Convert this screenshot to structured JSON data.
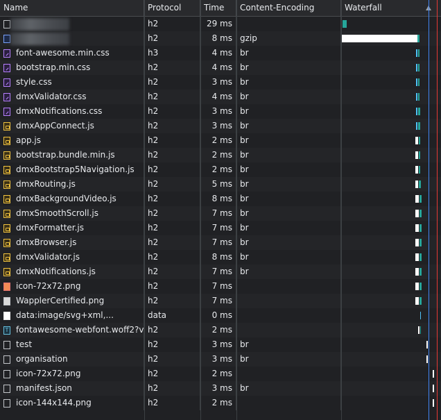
{
  "columns": {
    "name": "Name",
    "protocol": "Protocol",
    "time": "Time",
    "encoding": "Content-Encoding",
    "waterfall": "Waterfall"
  },
  "colors": {
    "background": "#202124",
    "blue_line": "#4285f4",
    "red_line": "#e53935",
    "teal_bar": "#26a69a"
  },
  "rows": [
    {
      "name": "",
      "blurred": true,
      "icon": "document-icon",
      "type": "doc",
      "protocol": "h2",
      "time": "29 ms",
      "encoding": ""
    },
    {
      "name": "",
      "blurred": true,
      "icon": "html-icon",
      "type": "html",
      "protocol": "h2",
      "time": "8 ms",
      "encoding": "gzip"
    },
    {
      "name": "font-awesome.min.css",
      "icon": "stylesheet-icon",
      "type": "css",
      "protocol": "h3",
      "time": "4 ms",
      "encoding": "br"
    },
    {
      "name": "bootstrap.min.css",
      "icon": "stylesheet-icon",
      "type": "css",
      "protocol": "h2",
      "time": "4 ms",
      "encoding": "br"
    },
    {
      "name": "style.css",
      "icon": "stylesheet-icon",
      "type": "css",
      "protocol": "h2",
      "time": "3 ms",
      "encoding": "br"
    },
    {
      "name": "dmxValidator.css",
      "icon": "stylesheet-icon",
      "type": "css",
      "protocol": "h2",
      "time": "4 ms",
      "encoding": "br"
    },
    {
      "name": "dmxNotifications.css",
      "icon": "stylesheet-icon",
      "type": "css",
      "protocol": "h2",
      "time": "3 ms",
      "encoding": "br"
    },
    {
      "name": "dmxAppConnect.js",
      "icon": "script-icon",
      "type": "js",
      "protocol": "h2",
      "time": "3 ms",
      "encoding": "br"
    },
    {
      "name": "app.js",
      "icon": "script-icon",
      "type": "js",
      "protocol": "h2",
      "time": "2 ms",
      "encoding": "br"
    },
    {
      "name": "bootstrap.bundle.min.js",
      "icon": "script-icon",
      "type": "js",
      "protocol": "h2",
      "time": "2 ms",
      "encoding": "br"
    },
    {
      "name": "dmxBootstrap5Navigation.js",
      "icon": "script-icon",
      "type": "js",
      "protocol": "h2",
      "time": "2 ms",
      "encoding": "br"
    },
    {
      "name": "dmxRouting.js",
      "icon": "script-icon",
      "type": "js",
      "protocol": "h2",
      "time": "5 ms",
      "encoding": "br"
    },
    {
      "name": "dmxBackgroundVideo.js",
      "icon": "script-icon",
      "type": "js",
      "protocol": "h2",
      "time": "8 ms",
      "encoding": "br"
    },
    {
      "name": "dmxSmoothScroll.js",
      "icon": "script-icon",
      "type": "js",
      "protocol": "h2",
      "time": "7 ms",
      "encoding": "br"
    },
    {
      "name": "dmxFormatter.js",
      "icon": "script-icon",
      "type": "js",
      "protocol": "h2",
      "time": "7 ms",
      "encoding": "br"
    },
    {
      "name": "dmxBrowser.js",
      "icon": "script-icon",
      "type": "js",
      "protocol": "h2",
      "time": "7 ms",
      "encoding": "br"
    },
    {
      "name": "dmxValidator.js",
      "icon": "script-icon",
      "type": "js",
      "protocol": "h2",
      "time": "8 ms",
      "encoding": "br"
    },
    {
      "name": "dmxNotifications.js",
      "icon": "script-icon",
      "type": "js",
      "protocol": "h2",
      "time": "7 ms",
      "encoding": "br"
    },
    {
      "name": "icon-72x72.png",
      "icon": "image-icon",
      "type": "img",
      "protocol": "h2",
      "time": "7 ms",
      "encoding": ""
    },
    {
      "name": "WapplerCertified.png",
      "icon": "image-icon",
      "type": "img2",
      "protocol": "h2",
      "time": "7 ms",
      "encoding": ""
    },
    {
      "name": "data:image/svg+xml,...",
      "icon": "data-image-icon",
      "type": "data",
      "protocol": "data",
      "time": "0 ms",
      "encoding": ""
    },
    {
      "name": "fontawesome-webfont.woff2?v...",
      "icon": "font-icon",
      "type": "font",
      "protocol": "h2",
      "time": "2 ms",
      "encoding": ""
    },
    {
      "name": "test",
      "icon": "document-icon",
      "type": "doc",
      "protocol": "h2",
      "time": "3 ms",
      "encoding": "br"
    },
    {
      "name": "organisation",
      "icon": "document-icon",
      "type": "doc",
      "protocol": "h2",
      "time": "3 ms",
      "encoding": "br"
    },
    {
      "name": "icon-72x72.png",
      "icon": "document-icon",
      "type": "doc",
      "protocol": "h2",
      "time": "2 ms",
      "encoding": ""
    },
    {
      "name": "manifest.json",
      "icon": "document-icon",
      "type": "doc",
      "protocol": "h2",
      "time": "3 ms",
      "encoding": "br"
    },
    {
      "name": "icon-144x144.png",
      "icon": "document-icon",
      "type": "doc",
      "protocol": "h2",
      "time": "2 ms",
      "encoding": ""
    }
  ]
}
